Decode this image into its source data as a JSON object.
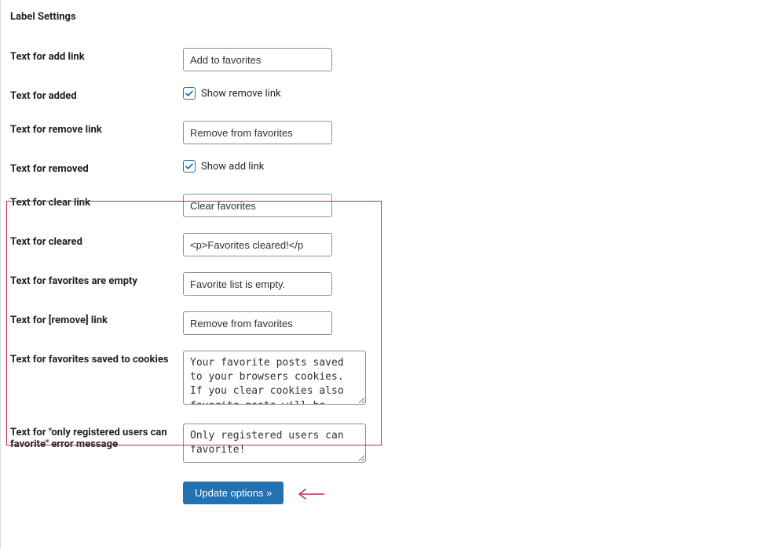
{
  "section_title": "Label Settings",
  "rows": {
    "add_link": {
      "label": "Text for add link",
      "value": "Add to favorites"
    },
    "added": {
      "label": "Text for added",
      "checkbox_label": "Show remove link",
      "checked": true
    },
    "remove_link": {
      "label": "Text for remove link",
      "value": "Remove from favorites"
    },
    "removed": {
      "label": "Text for removed",
      "checkbox_label": "Show add link",
      "checked": true
    },
    "clear_link": {
      "label": "Text for clear link",
      "value": "Clear favorites"
    },
    "cleared": {
      "label": "Text for cleared",
      "value": "<p>Favorites cleared!</p"
    },
    "empty": {
      "label": "Text for favorites are empty",
      "value": "Favorite list is empty."
    },
    "remove_bracket": {
      "label": "Text for [remove] link",
      "value": "Remove from favorites"
    },
    "saved_cookies": {
      "label": "Text for favorites saved to cookies",
      "value": "Your favorite posts saved to your browsers cookies. If you clear cookies also favorite posts will be deleted."
    },
    "only_registered": {
      "label": "Text for \"only registered users can favorite\" error message",
      "value": "Only registered users can favorite!"
    }
  },
  "submit_label": "Update options »"
}
